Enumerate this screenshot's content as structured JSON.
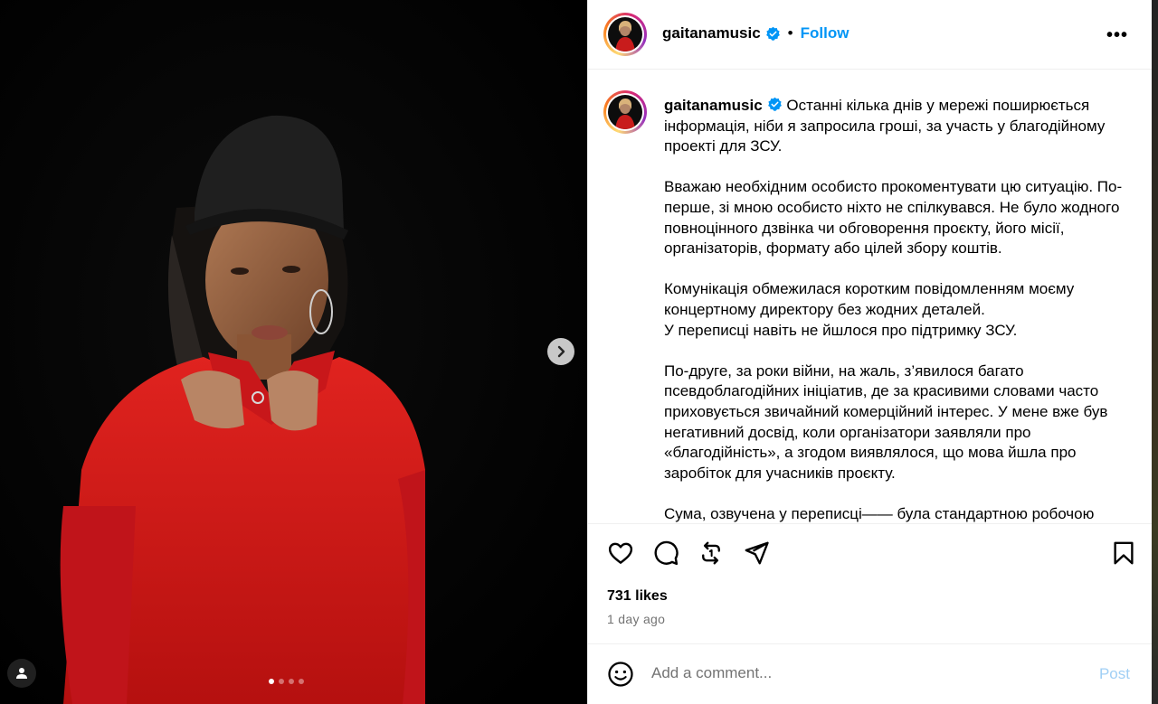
{
  "post": {
    "username": "gaitanamusic",
    "follow_label": "Follow",
    "separator": "•",
    "more_label": "•••",
    "caption_paragraphs": [
      "Останні кілька днів у мережі поширюється інформація, ніби я запросила гроші, за участь у благодійному проекті для ЗСУ.",
      "Вважаю необхідним особисто прокоментувати цю ситуацію. По-перше, зі мною особисто ніхто не спілкувався. Не було жодного повноцінного дзвінка чи обговорення проєкту, його місії, організаторів, формату або цілей збору коштів.",
      "Комунікація обмежилася коротким повідомленням моєму концертному директору без жодних деталей.\nУ переписці навіть не йшлося про підтримку ЗСУ.",
      "По-друге, за роки війни, на жаль, з’явилося багато псевдоблагодійних ініціатив, де за красивими словами часто приховується звичайний комерційний інтерес. У мене вже був негативний досвід, коли організатори заявляли про «благодійність», а згодом виявлялося, що мова йшла про заробіток для учасників проєкту.",
      "Сума, озвучена у переписці—— була стандартною робочою"
    ],
    "likes": "731 likes",
    "time_ago": "1 day ago",
    "comment_placeholder": "Add a comment...",
    "post_label": "Post"
  },
  "carousel": {
    "total": 4,
    "active": 1
  },
  "colors": {
    "accent": "#0095f6",
    "verified": "#0095f6",
    "sweater": "#d91a1a"
  },
  "icons": [
    "heart-icon",
    "comment-icon",
    "repost-icon",
    "share-icon",
    "bookmark-icon",
    "emoji-icon",
    "chevron-right-icon",
    "user-tag-icon",
    "verified-badge-icon"
  ]
}
